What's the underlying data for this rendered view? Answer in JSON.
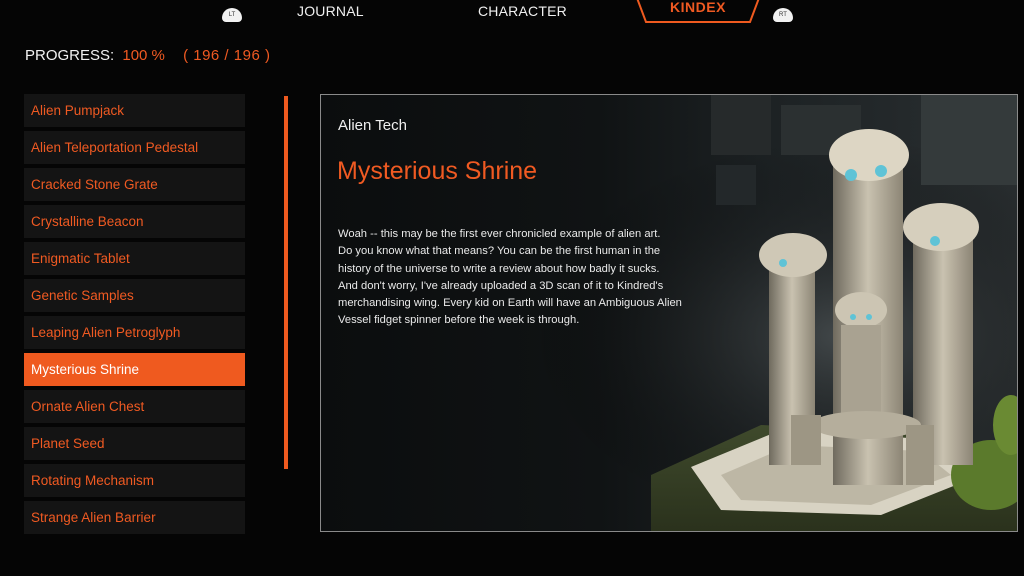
{
  "top_nav": {
    "lt_label": "LT",
    "rt_label": "RT",
    "tabs": [
      {
        "label": "JOURNAL"
      },
      {
        "label": "CHARACTER"
      },
      {
        "label": "KINDEX",
        "active": true
      }
    ]
  },
  "progress": {
    "label": "PROGRESS:",
    "percent": "100 %",
    "count": "( 196 / 196 )"
  },
  "entries": [
    {
      "label": "Alien Pumpjack"
    },
    {
      "label": "Alien Teleportation Pedestal"
    },
    {
      "label": "Cracked Stone Grate"
    },
    {
      "label": "Crystalline Beacon"
    },
    {
      "label": "Enigmatic Tablet"
    },
    {
      "label": "Genetic Samples"
    },
    {
      "label": "Leaping Alien Petroglyph"
    },
    {
      "label": "Mysterious Shrine",
      "selected": true
    },
    {
      "label": "Ornate Alien Chest"
    },
    {
      "label": "Planet Seed"
    },
    {
      "label": "Rotating Mechanism"
    },
    {
      "label": "Strange Alien Barrier"
    }
  ],
  "detail": {
    "category": "Alien Tech",
    "title": "Mysterious Shrine",
    "description": [
      "Woah -- this may be the first ever chronicled example of alien art.",
      "Do you know what that means? You can be the first human in the",
      "history of the universe to write a review about how badly it sucks.",
      "And don't worry, I've already uploaded a 3D scan of it to Kindred's",
      "merchandising wing. Every kid on Earth will have an Ambiguous Alien",
      "Vessel fidget spinner before the week is through."
    ]
  },
  "colors": {
    "accent": "#ef5a1f",
    "list_bg": "#141414",
    "panel_border": "#8a8a8a"
  }
}
